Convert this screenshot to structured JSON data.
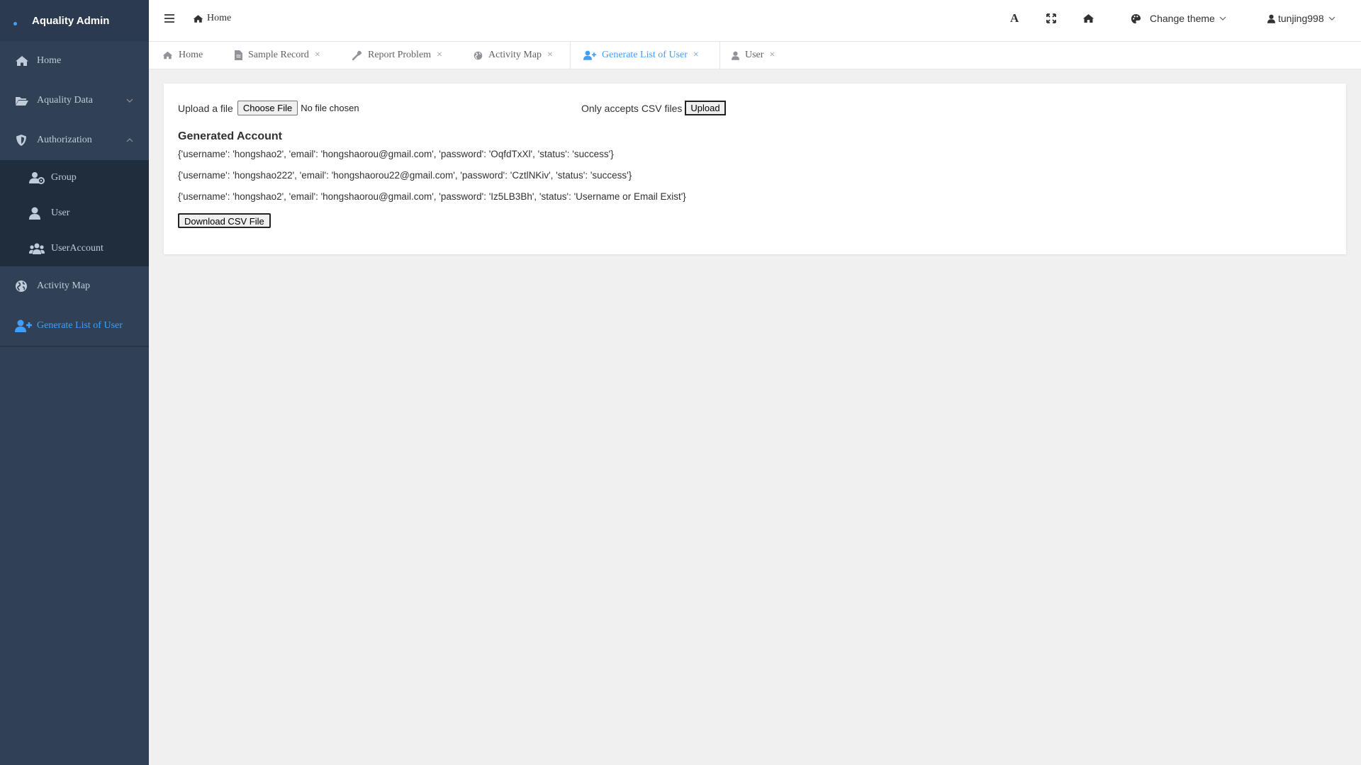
{
  "app": {
    "title": "Aquality Admin"
  },
  "colors": {
    "sidebar_bg": "#304156",
    "sidebar_sub_bg": "#1f2d3d",
    "accent": "#409eff"
  },
  "sidebar": {
    "items": [
      {
        "label": "Home",
        "icon": "home-icon"
      },
      {
        "label": "Aquality Data",
        "icon": "folder-open-icon"
      },
      {
        "label": "Authorization",
        "icon": "shield-icon"
      },
      {
        "label": "Group",
        "icon": "user-group-icon"
      },
      {
        "label": "User",
        "icon": "user-icon"
      },
      {
        "label": "UserAccount",
        "icon": "users-icon"
      },
      {
        "label": "Activity Map",
        "icon": "globe-icon"
      },
      {
        "label": "Generate List of User",
        "icon": "user-plus-icon"
      }
    ]
  },
  "header": {
    "breadcrumb": "Home",
    "theme_label": "Change theme",
    "username": "tunjing998",
    "font_icon_label": "A"
  },
  "tabs": [
    {
      "label": "Home",
      "icon": "home-icon"
    },
    {
      "label": "Sample Record",
      "icon": "file-icon"
    },
    {
      "label": "Report Problem",
      "icon": "wrench-icon"
    },
    {
      "label": "Activity Map",
      "icon": "globe-icon"
    },
    {
      "label": "Generate List of User",
      "icon": "user-plus-icon"
    },
    {
      "label": "User",
      "icon": "user-icon"
    }
  ],
  "tab_close": "×",
  "main": {
    "upload_label": "Upload a file",
    "choose_file": "Choose File",
    "no_file": "No file chosen",
    "csv_note": "Only accepts CSV files",
    "upload_button": "Upload",
    "generated_title": "Generated Account",
    "accounts": [
      "{'username': 'hongshao2', 'email': 'hongshaorou@gmail.com', 'password': 'OqfdTxXl', 'status': 'success'}",
      "{'username': 'hongshao222', 'email': 'hongshaorou22@gmail.com', 'password': 'CztlNKiv', 'status': 'success'}",
      "{'username': 'hongshao2', 'email': 'hongshaorou@gmail.com', 'password': 'Iz5LB3Bh', 'status': 'Username or Email Exist'}"
    ],
    "download_button": "Download CSV File"
  }
}
